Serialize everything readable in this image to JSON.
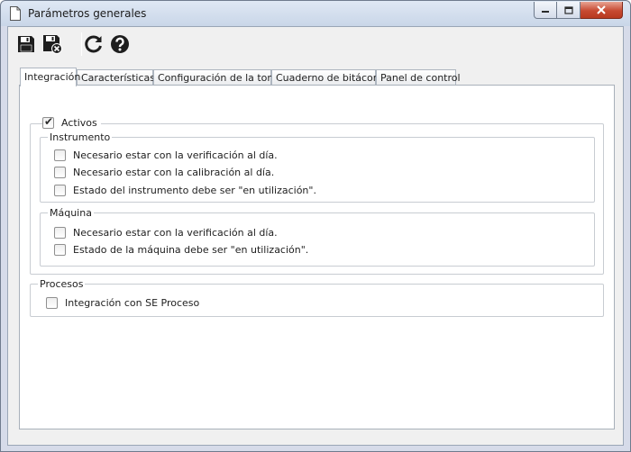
{
  "window": {
    "title": "Parámetros generales"
  },
  "toolbar": {
    "save": "save-icon",
    "save_close": "save-close-icon",
    "refresh": "refresh-icon",
    "help": "help-icon"
  },
  "tabs": [
    {
      "label": "Integración",
      "active": true
    },
    {
      "label": "Características",
      "active": false
    },
    {
      "label": "Configuración de la toma",
      "active": false
    },
    {
      "label": "Cuaderno de bitácora",
      "active": false
    },
    {
      "label": "Panel de control",
      "active": false
    }
  ],
  "activos": {
    "label": "Activos",
    "checked": true,
    "instrumento": {
      "legend": "Instrumento",
      "items": [
        {
          "label": "Necesario estar con la verificación al día.",
          "checked": false
        },
        {
          "label": "Necesario estar con la calibración al día.",
          "checked": false
        },
        {
          "label": "Estado del instrumento debe ser \"en utilización\".",
          "checked": false
        }
      ]
    },
    "maquina": {
      "legend": "Máquina",
      "items": [
        {
          "label": "Necesario estar con la verificación al día.",
          "checked": false
        },
        {
          "label": "Estado de la máquina debe ser \"en utilización\".",
          "checked": false
        }
      ]
    }
  },
  "procesos": {
    "legend": "Procesos",
    "items": [
      {
        "label": "Integración con SE Proceso",
        "checked": false
      }
    ]
  }
}
